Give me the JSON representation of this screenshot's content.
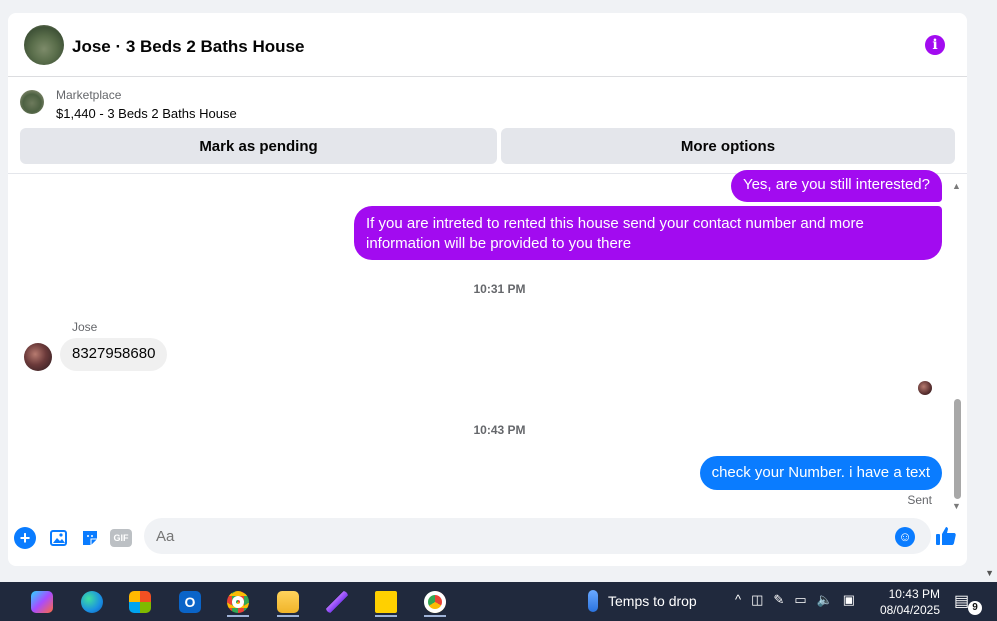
{
  "header": {
    "title": "Jose · 3 Beds 2 Baths House",
    "info_icon": "info-icon"
  },
  "marketplace": {
    "label": "Marketplace",
    "listing": "$1,440 - 3 Beds 2 Baths House",
    "pending_label": "Mark as pending",
    "more_label": "More options"
  },
  "thread": {
    "messages": [
      {
        "text": "Yes, are you still interested?"
      },
      {
        "text": "If you are intreted to rented this house send your contact number and more information will be provided to you there"
      },
      {
        "text": "8327958680",
        "sender": "Jose"
      },
      {
        "text": "check your Number. i have a text"
      }
    ],
    "times": [
      "10:31 PM",
      "10:43 PM"
    ],
    "status": "Sent"
  },
  "composer": {
    "placeholder": "Aa",
    "gif_label": "GIF"
  },
  "taskbar": {
    "weather": "Temps to drop",
    "time": "10:43 PM",
    "date": "08/04/2025",
    "notification_count": "9"
  },
  "colors": {
    "accent": "#a20bf0",
    "blue": "#0a7cff"
  }
}
